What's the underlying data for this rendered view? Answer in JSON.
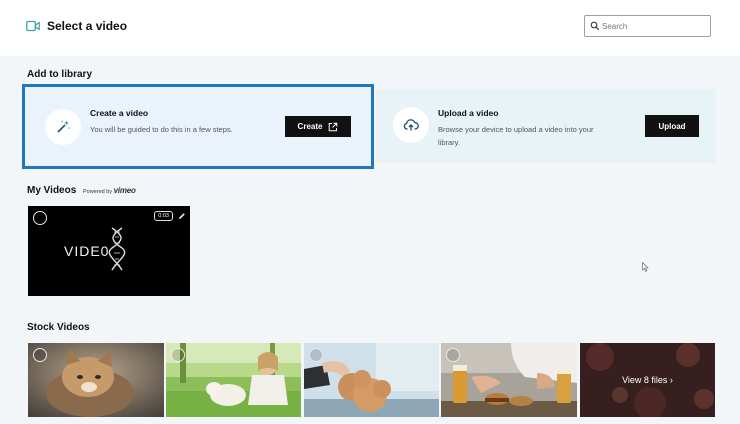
{
  "header": {
    "title": "Select a video",
    "search_placeholder": "Search"
  },
  "library": {
    "section_title": "Add to library",
    "create": {
      "title": "Create a video",
      "description": "You will be guided to do this in a few steps.",
      "button_label": "Create"
    },
    "upload": {
      "title": "Upload a video",
      "description": "Browse your device to upload a video into your library.",
      "button_label": "Upload"
    }
  },
  "my_videos": {
    "section_title": "My Videos",
    "powered_prefix": "Powered by",
    "powered_brand": "vimeo",
    "items": [
      {
        "title_text": "VIDE0",
        "duration": "0:03"
      }
    ]
  },
  "stock_videos": {
    "section_title": "Stock Videos",
    "items": [
      {
        "subject": "kitten"
      },
      {
        "subject": "girl-with-puppy"
      },
      {
        "subject": "poodle-being-groomed"
      },
      {
        "subject": "people-with-beer-and-burger"
      }
    ],
    "view_more_label": "View 8 files ›"
  },
  "colors": {
    "highlight_border": "#1f77c2",
    "button_bg": "#111111",
    "card_bg": "#e7f3f6",
    "page_bg": "#f3f6f8"
  },
  "icons": {
    "header": "video-camera-icon",
    "search": "search-icon",
    "create": "magic-wand-icon",
    "create_button": "external-link-icon",
    "upload": "cloud-upload-icon",
    "video_edit": "edit-icon"
  }
}
